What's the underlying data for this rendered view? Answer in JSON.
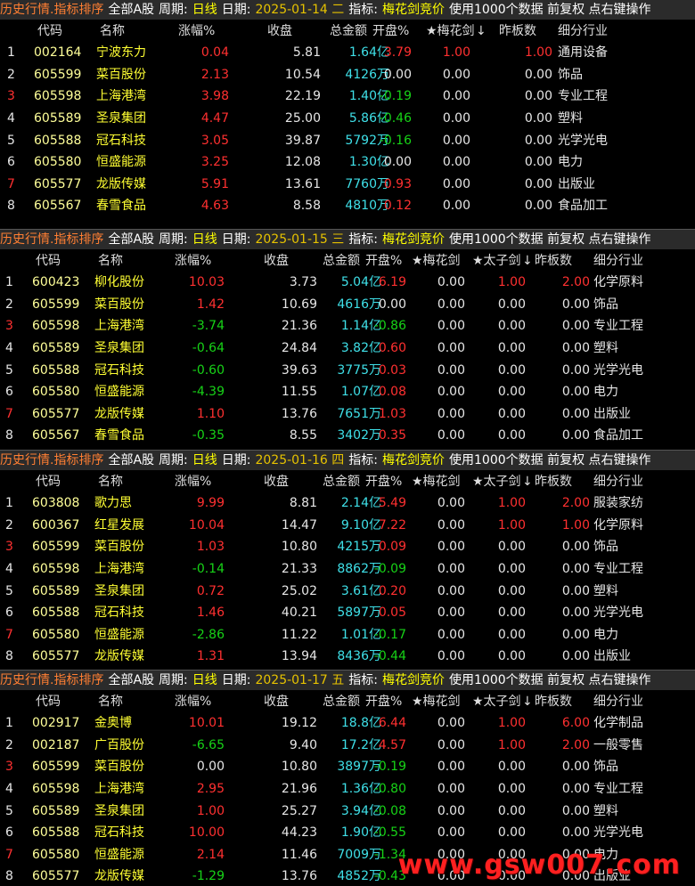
{
  "colors": {
    "red": "#ff3030",
    "green": "#17d317",
    "cyan": "#3fe0e8",
    "yellow": "#ffff33",
    "bg": "#000000"
  },
  "headers": {
    "code": "代码",
    "name": "名称",
    "chg": "涨幅%",
    "close": "收盘",
    "amount": "总金额",
    "open": "开盘%",
    "plum": "★梅花剑",
    "prince": "★太子剑",
    "prev": "昨板数",
    "industry": "细分行业"
  },
  "panels": [
    {
      "title": {
        "name": "历史行情.指标排序",
        "board": "全部A股",
        "period_label": "周期:",
        "period": "日线",
        "date_label": "日期:",
        "date": "2025-01-14 二",
        "ind_label": "指标:",
        "indicator": "梅花剑竞价",
        "misc": "使用1000个数据 前复权 点右键操作"
      },
      "has_prince": false,
      "rows": [
        {
          "n": "1",
          "code": "002164",
          "name": "宁波东力",
          "chg": "0.04",
          "close": "5.81",
          "amount": "1.64亿",
          "open": "3.79",
          "plum": "1.00",
          "prince": "",
          "prev": "1.00",
          "industry": "通用设备"
        },
        {
          "n": "2",
          "code": "605599",
          "name": "菜百股份",
          "chg": "2.13",
          "close": "10.54",
          "amount": "4126万",
          "open": "0.00",
          "plum": "0.00",
          "prince": "",
          "prev": "0.00",
          "industry": "饰品"
        },
        {
          "n": "3",
          "code": "605598",
          "name": "上海港湾",
          "chg": "3.98",
          "close": "22.19",
          "amount": "1.40亿",
          "open": "-0.19",
          "plum": "0.00",
          "prince": "",
          "prev": "0.00",
          "industry": "专业工程"
        },
        {
          "n": "4",
          "code": "605589",
          "name": "圣泉集团",
          "chg": "4.47",
          "close": "25.00",
          "amount": "5.86亿",
          "open": "-0.46",
          "plum": "0.00",
          "prince": "",
          "prev": "0.00",
          "industry": "塑料"
        },
        {
          "n": "5",
          "code": "605588",
          "name": "冠石科技",
          "chg": "3.05",
          "close": "39.87",
          "amount": "5792万",
          "open": "-0.16",
          "plum": "0.00",
          "prince": "",
          "prev": "0.00",
          "industry": "光学光电"
        },
        {
          "n": "6",
          "code": "605580",
          "name": "恒盛能源",
          "chg": "3.25",
          "close": "12.08",
          "amount": "1.30亿",
          "open": "0.00",
          "plum": "0.00",
          "prince": "",
          "prev": "0.00",
          "industry": "电力"
        },
        {
          "n": "7",
          "code": "605577",
          "name": "龙版传媒",
          "chg": "5.91",
          "close": "13.61",
          "amount": "7760万",
          "open": "0.93",
          "plum": "0.00",
          "prince": "",
          "prev": "0.00",
          "industry": "出版业"
        },
        {
          "n": "8",
          "code": "605567",
          "name": "春雪食品",
          "chg": "4.63",
          "close": "8.58",
          "amount": "4810万",
          "open": "0.12",
          "plum": "0.00",
          "prince": "",
          "prev": "0.00",
          "industry": "食品加工"
        }
      ]
    },
    {
      "title": {
        "name": "历史行情.指标排序",
        "board": "全部A股",
        "period_label": "周期:",
        "period": "日线",
        "date_label": "日期:",
        "date": "2025-01-15 三",
        "ind_label": "指标:",
        "indicator": "梅花剑竞价",
        "misc": "使用1000个数据 前复权 点右键操作"
      },
      "has_prince": true,
      "rows": [
        {
          "n": "1",
          "code": "600423",
          "name": "柳化股份",
          "chg": "10.03",
          "close": "3.73",
          "amount": "5.04亿",
          "open": "6.19",
          "plum": "0.00",
          "prince": "1.00",
          "prev": "2.00",
          "industry": "化学原料"
        },
        {
          "n": "2",
          "code": "605599",
          "name": "菜百股份",
          "chg": "1.42",
          "close": "10.69",
          "amount": "4616万",
          "open": "0.00",
          "plum": "0.00",
          "prince": "0.00",
          "prev": "0.00",
          "industry": "饰品"
        },
        {
          "n": "3",
          "code": "605598",
          "name": "上海港湾",
          "chg": "-3.74",
          "close": "21.36",
          "amount": "1.14亿",
          "open": "-0.86",
          "plum": "0.00",
          "prince": "0.00",
          "prev": "0.00",
          "industry": "专业工程"
        },
        {
          "n": "4",
          "code": "605589",
          "name": "圣泉集团",
          "chg": "-0.64",
          "close": "24.84",
          "amount": "3.82亿",
          "open": "0.60",
          "plum": "0.00",
          "prince": "0.00",
          "prev": "0.00",
          "industry": "塑料"
        },
        {
          "n": "5",
          "code": "605588",
          "name": "冠石科技",
          "chg": "-0.60",
          "close": "39.63",
          "amount": "3775万",
          "open": "0.03",
          "plum": "0.00",
          "prince": "0.00",
          "prev": "0.00",
          "industry": "光学光电"
        },
        {
          "n": "6",
          "code": "605580",
          "name": "恒盛能源",
          "chg": "-4.39",
          "close": "11.55",
          "amount": "1.07亿",
          "open": "0.08",
          "plum": "0.00",
          "prince": "0.00",
          "prev": "0.00",
          "industry": "电力"
        },
        {
          "n": "7",
          "code": "605577",
          "name": "龙版传媒",
          "chg": "1.10",
          "close": "13.76",
          "amount": "7651万",
          "open": "1.03",
          "plum": "0.00",
          "prince": "0.00",
          "prev": "0.00",
          "industry": "出版业"
        },
        {
          "n": "8",
          "code": "605567",
          "name": "春雪食品",
          "chg": "-0.35",
          "close": "8.55",
          "amount": "3402万",
          "open": "0.35",
          "plum": "0.00",
          "prince": "0.00",
          "prev": "0.00",
          "industry": "食品加工"
        }
      ]
    },
    {
      "title": {
        "name": "历史行情.指标排序",
        "board": "全部A股",
        "period_label": "周期:",
        "period": "日线",
        "date_label": "日期:",
        "date": "2025-01-16 四",
        "ind_label": "指标:",
        "indicator": "梅花剑竞价",
        "misc": "使用1000个数据 前复权 点右键操作"
      },
      "has_prince": true,
      "rows": [
        {
          "n": "1",
          "code": "603808",
          "name": "歌力思",
          "chg": "9.99",
          "close": "8.81",
          "amount": "2.14亿",
          "open": "5.49",
          "plum": "0.00",
          "prince": "1.00",
          "prev": "2.00",
          "industry": "服装家纺"
        },
        {
          "n": "2",
          "code": "600367",
          "name": "红星发展",
          "chg": "10.04",
          "close": "14.47",
          "amount": "9.10亿",
          "open": "7.22",
          "plum": "0.00",
          "prince": "1.00",
          "prev": "1.00",
          "industry": "化学原料"
        },
        {
          "n": "3",
          "code": "605599",
          "name": "菜百股份",
          "chg": "1.03",
          "close": "10.80",
          "amount": "4215万",
          "open": "0.09",
          "plum": "0.00",
          "prince": "0.00",
          "prev": "0.00",
          "industry": "饰品"
        },
        {
          "n": "4",
          "code": "605598",
          "name": "上海港湾",
          "chg": "-0.14",
          "close": "21.33",
          "amount": "8862万",
          "open": "-0.09",
          "plum": "0.00",
          "prince": "0.00",
          "prev": "0.00",
          "industry": "专业工程"
        },
        {
          "n": "5",
          "code": "605589",
          "name": "圣泉集团",
          "chg": "0.72",
          "close": "25.02",
          "amount": "3.61亿",
          "open": "0.20",
          "plum": "0.00",
          "prince": "0.00",
          "prev": "0.00",
          "industry": "塑料"
        },
        {
          "n": "6",
          "code": "605588",
          "name": "冠石科技",
          "chg": "1.46",
          "close": "40.21",
          "amount": "5897万",
          "open": "0.05",
          "plum": "0.00",
          "prince": "0.00",
          "prev": "0.00",
          "industry": "光学光电"
        },
        {
          "n": "7",
          "code": "605580",
          "name": "恒盛能源",
          "chg": "-2.86",
          "close": "11.22",
          "amount": "1.01亿",
          "open": "-0.17",
          "plum": "0.00",
          "prince": "0.00",
          "prev": "0.00",
          "industry": "电力"
        },
        {
          "n": "8",
          "code": "605577",
          "name": "龙版传媒",
          "chg": "1.31",
          "close": "13.94",
          "amount": "8436万",
          "open": "-0.44",
          "plum": "0.00",
          "prince": "0.00",
          "prev": "0.00",
          "industry": "出版业"
        }
      ]
    },
    {
      "title": {
        "name": "历史行情.指标排序",
        "board": "全部A股",
        "period_label": "周期:",
        "period": "日线",
        "date_label": "日期:",
        "date": "2025-01-17 五",
        "ind_label": "指标:",
        "indicator": "梅花剑竞价",
        "misc": "使用1000个数据 前复权 点右键操作"
      },
      "has_prince": true,
      "rows": [
        {
          "n": "1",
          "code": "002917",
          "name": "金奥博",
          "chg": "10.01",
          "close": "19.12",
          "amount": "18.8亿",
          "open": "6.44",
          "plum": "0.00",
          "prince": "1.00",
          "prev": "6.00",
          "industry": "化学制品"
        },
        {
          "n": "2",
          "code": "002187",
          "name": "广百股份",
          "chg": "-6.65",
          "close": "9.40",
          "amount": "17.2亿",
          "open": "4.57",
          "plum": "0.00",
          "prince": "1.00",
          "prev": "2.00",
          "industry": "一般零售"
        },
        {
          "n": "3",
          "code": "605599",
          "name": "菜百股份",
          "chg": "0.00",
          "close": "10.80",
          "amount": "3897万",
          "open": "-0.19",
          "plum": "0.00",
          "prince": "0.00",
          "prev": "0.00",
          "industry": "饰品"
        },
        {
          "n": "4",
          "code": "605598",
          "name": "上海港湾",
          "chg": "2.95",
          "close": "21.96",
          "amount": "1.36亿",
          "open": "-0.80",
          "plum": "0.00",
          "prince": "0.00",
          "prev": "0.00",
          "industry": "专业工程"
        },
        {
          "n": "5",
          "code": "605589",
          "name": "圣泉集团",
          "chg": "1.00",
          "close": "25.27",
          "amount": "3.94亿",
          "open": "-0.08",
          "plum": "0.00",
          "prince": "0.00",
          "prev": "0.00",
          "industry": "塑料"
        },
        {
          "n": "6",
          "code": "605588",
          "name": "冠石科技",
          "chg": "10.00",
          "close": "44.23",
          "amount": "1.90亿",
          "open": "-0.55",
          "plum": "0.00",
          "prince": "0.00",
          "prev": "0.00",
          "industry": "光学光电"
        },
        {
          "n": "7",
          "code": "605580",
          "name": "恒盛能源",
          "chg": "2.14",
          "close": "11.46",
          "amount": "7009万",
          "open": "-1.34",
          "plum": "0.00",
          "prince": "0.00",
          "prev": "0.00",
          "industry": "电力"
        },
        {
          "n": "8",
          "code": "605577",
          "name": "龙版传媒",
          "chg": "-1.29",
          "close": "13.76",
          "amount": "4852万",
          "open": "-0.43",
          "plum": "0.00",
          "prince": "0.00",
          "prev": "0.00",
          "industry": "出版业"
        }
      ]
    }
  ],
  "watermark": "www.gsw007.com"
}
